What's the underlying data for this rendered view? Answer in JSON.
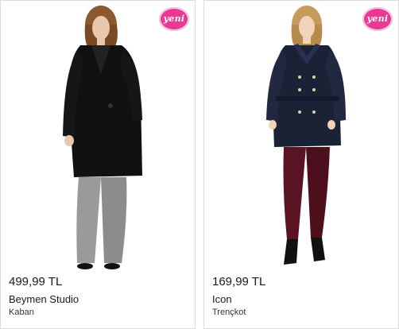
{
  "products": [
    {
      "badge": "yeni",
      "price": "499,99 TL",
      "brand": "Beymen Studio",
      "category": "Kaban",
      "image_icon": "model-black-coat-image",
      "colors": {
        "coat": "#111111",
        "trousers": "#9a9a9a",
        "skin": "#e9c9ad",
        "hair": "#8a5a2e"
      }
    },
    {
      "badge": "yeni",
      "price": "169,99 TL",
      "brand": "Icon",
      "category": "Trençkot",
      "image_icon": "model-navy-trench-coat-image",
      "colors": {
        "coat": "#1c2236",
        "trousers": "#5a1322",
        "skin": "#f0d3b8",
        "hair": "#c79a5c"
      }
    }
  ],
  "badge_color": "#e83a95"
}
